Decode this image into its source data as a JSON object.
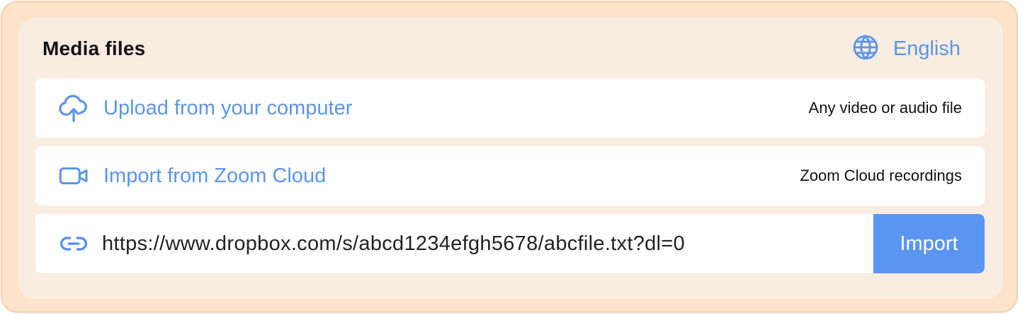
{
  "section": {
    "title": "Media files"
  },
  "language": {
    "label": "English",
    "icon": "globe-icon"
  },
  "options": [
    {
      "label": "Upload from your computer",
      "hint": "Any video or audio file",
      "icon": "cloud-upload-icon"
    },
    {
      "label": "Import from Zoom Cloud",
      "hint": "Zoom Cloud recordings",
      "icon": "video-camera-icon"
    }
  ],
  "url_import": {
    "icon": "link-icon",
    "value": "https://www.dropbox.com/s/abcd1234efgh5678/abcfile.txt?dl=0",
    "button_label": "Import"
  },
  "colors": {
    "accent": "#5b95e8",
    "button": "#5b95f2",
    "outer_background": "#fde3c9",
    "panel_background": "#f9ece0"
  }
}
